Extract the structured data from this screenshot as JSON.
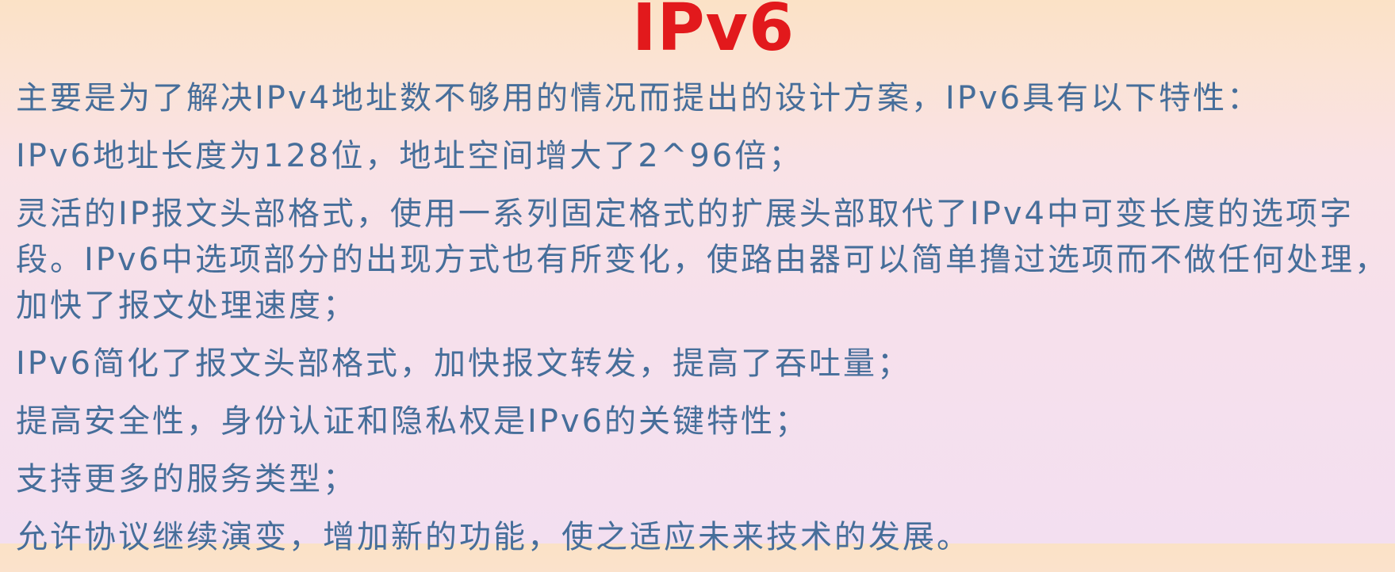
{
  "slide": {
    "title": "IPv6",
    "paragraphs": [
      "主要是为了解决IPv4地址数不够用的情况而提出的设计方案，IPv6具有以下特性：",
      "IPv6地址长度为128位，地址空间增大了2^96倍；",
      "灵活的IP报文头部格式，使用一系列固定格式的扩展头部取代了IPv4中可变长度的选项字段。IPv6中选项部分的出现方式也有所变化，使路由器可以简单撸过选项而不做任何处理，加快了报文处理速度；",
      "IPv6简化了报文头部格式，加快报文转发，提高了吞吐量；",
      "提高安全性，身份认证和隐私权是IPv6的关键特性；",
      "支持更多的服务类型；",
      "允许协议继续演变，增加新的功能，使之适应未来技术的发展。"
    ]
  },
  "colors": {
    "title": "#e2191c",
    "body_text": "#466e9a"
  }
}
